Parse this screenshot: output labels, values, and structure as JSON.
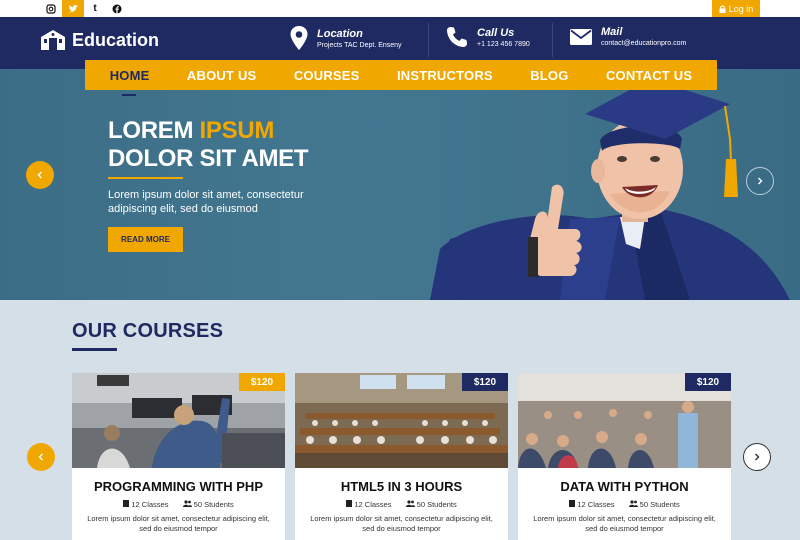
{
  "topbar": {
    "social": [
      "instagram-icon",
      "twitter-icon",
      "tumblr-icon",
      "facebook-icon"
    ],
    "login_label": "Log in"
  },
  "header": {
    "logo": "Education",
    "contacts": [
      {
        "title": "Location",
        "sub": "Projects TAC Dept. Enseny",
        "icon": "location-pin-icon"
      },
      {
        "title": "Call Us",
        "sub": "+1 123 456 7890",
        "icon": "phone-icon"
      },
      {
        "title": "Mail",
        "sub": "contact@educationpro.com",
        "icon": "mail-icon"
      }
    ]
  },
  "nav": {
    "items": [
      "HOME",
      "ABOUT US",
      "COURSES",
      "INSTRUCTORS",
      "BLOG",
      "CONTACT US"
    ],
    "active": "HOME"
  },
  "hero": {
    "title_part1": "LOREM ",
    "title_highlight": "IPSUM",
    "title_line2": "DOLOR SIT AMET",
    "text": "Lorem ipsum dolor sit amet, consectetur adipiscing elit, sed do eiusmod",
    "button": "READ MORE"
  },
  "courses": {
    "title": "OUR COURSES",
    "items": [
      {
        "price": "$120",
        "title": "PROGRAMMING WITH PHP",
        "classes": "12 Classes",
        "students": "50 Students",
        "desc": "Lorem ipsum dolor sit amet, consectetur adipiscing elit, sed do eiusmod tempor"
      },
      {
        "price": "$120",
        "title": "HTML5 IN 3 HOURS",
        "classes": "12 Classes",
        "students": "50 Students",
        "desc": "Lorem ipsum dolor sit amet, consectetur adipiscing elit, sed do eiusmod tempor"
      },
      {
        "price": "$120",
        "title": "DATA WITH PYTHON",
        "classes": "12 Classes",
        "students": "50 Students",
        "desc": "Lorem ipsum dolor sit amet, consectetur adipiscing elit, sed do eiusmod tempor"
      }
    ]
  },
  "colors": {
    "navy": "#1f2a62",
    "accent": "#f0a800"
  }
}
